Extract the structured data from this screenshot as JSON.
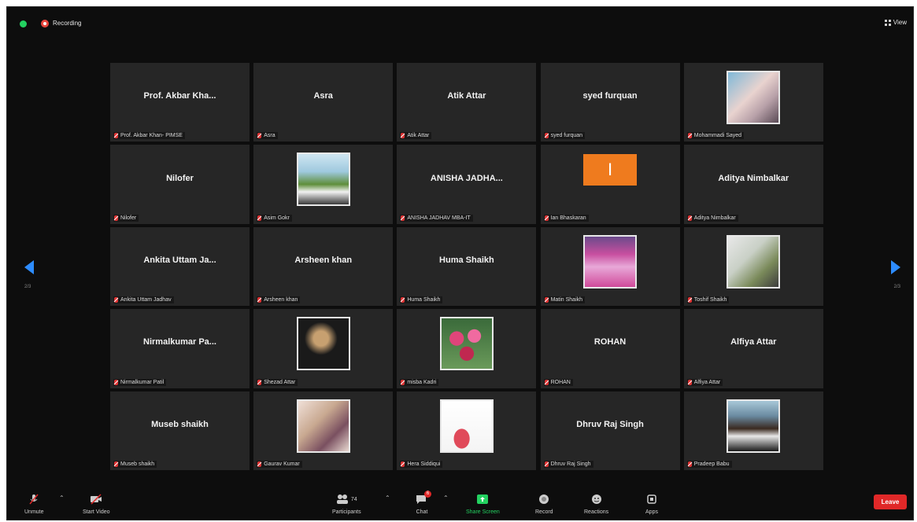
{
  "topbar": {
    "recording": "Recording",
    "view": "View"
  },
  "nav": {
    "page_left": "2/3",
    "page_right": "2/3"
  },
  "tiles": [
    {
      "big": "Prof. Akbar Kha...",
      "name": "Prof. Akbar Khan- PIMSE"
    },
    {
      "big": "Asra",
      "name": "Asra"
    },
    {
      "big": "Atik Attar",
      "name": "Atik Attar"
    },
    {
      "big": "syed furquan",
      "name": "syed furquan"
    },
    {
      "photo": "photo-mohammadi",
      "name": "Mohammadi Sayed"
    },
    {
      "big": "Nilofer",
      "name": "Nilofer"
    },
    {
      "photo": "photo-asim",
      "name": "Asim Gokr"
    },
    {
      "big": "ANISHA JADHA...",
      "name": "ANISHA JADHAV MBA-IT"
    },
    {
      "initial": "I",
      "name": "Ian Bhaskaran"
    },
    {
      "big": "Aditya Nimbalkar",
      "name": "Aditya Nimbalkar"
    },
    {
      "big": "Ankita Uttam Ja...",
      "name": "Ankita Uttam Jadhav"
    },
    {
      "big": "Arsheen khan",
      "name": "Arsheen khan"
    },
    {
      "big": "Huma Shaikh",
      "name": "Huma Shaikh"
    },
    {
      "photo": "photo-matin",
      "name": "Matin Shaikh"
    },
    {
      "photo": "photo-toshif",
      "name": "Toshif Shaikh"
    },
    {
      "big": "Nirmalkumar  Pa...",
      "name": "Nirmalkumar Patil"
    },
    {
      "photo": "photo-shezad",
      "name": "Shezad Attar"
    },
    {
      "photo": "photo-misba",
      "name": "misba Kadri"
    },
    {
      "big": "ROHAN",
      "name": "ROHAN"
    },
    {
      "big": "Alfiya Attar",
      "name": "Alfiya Attar"
    },
    {
      "big": "Museb shaikh",
      "name": "Museb shaikh"
    },
    {
      "photo": "photo-gaurav",
      "name": "Gaurav Kumar"
    },
    {
      "photo": "photo-hera",
      "name": "Hera Siddiqui"
    },
    {
      "big": "Dhruv Raj Singh",
      "name": "Dhruv Raj Singh"
    },
    {
      "photo": "photo-pradeep",
      "name": "Pradeep Babu"
    }
  ],
  "toolbar": {
    "unmute": "Unmute",
    "start_video": "Start Video",
    "participants": "Participants",
    "participants_count": "74",
    "chat": "Chat",
    "chat_badge": "6",
    "share_screen": "Share Screen",
    "record": "Record",
    "reactions": "Reactions",
    "apps": "Apps",
    "leave": "Leave"
  },
  "colors": {
    "accent": "#2d8cff",
    "share": "#23d160",
    "leave": "#e02828",
    "tile": "#262626"
  }
}
